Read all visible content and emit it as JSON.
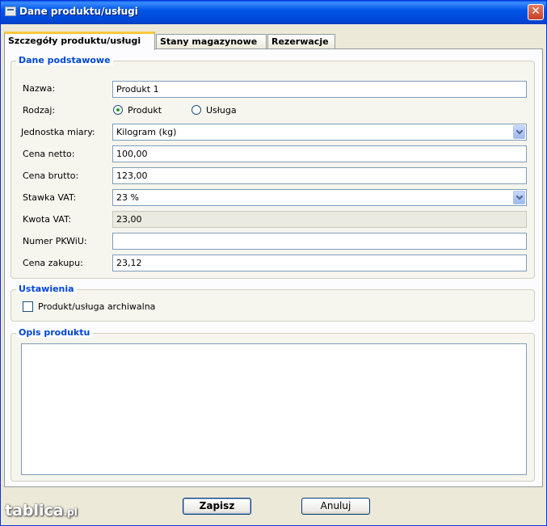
{
  "window": {
    "title": "Dane produktu/usługi",
    "close_label": "✕"
  },
  "tabs": [
    {
      "label": "Szczegóły produktu/usługi",
      "active": true
    },
    {
      "label": "Stany magazynowe",
      "active": false
    },
    {
      "label": "Rezerwacje",
      "active": false
    }
  ],
  "basic": {
    "legend": "Dane podstawowe",
    "name_label": "Nazwa:",
    "name_value": "Produkt 1",
    "type_label": "Rodzaj:",
    "type_options": [
      {
        "label": "Produkt",
        "selected": true
      },
      {
        "label": "Usługa",
        "selected": false
      }
    ],
    "unit_label": "Jednostka miary:",
    "unit_value": "Kilogram (kg)",
    "net_label": "Cena netto:",
    "net_value": "100,00",
    "gross_label": "Cena brutto:",
    "gross_value": "123,00",
    "vat_rate_label": "Stawka VAT:",
    "vat_rate_value": "23 %",
    "vat_amount_label": "Kwota VAT:",
    "vat_amount_value": "23,00",
    "pkwiu_label": "Numer PKWiU:",
    "pkwiu_value": "",
    "purchase_label": "Cena zakupu:",
    "purchase_value": "23,12"
  },
  "settings": {
    "legend": "Ustawienia",
    "archive_label": "Produkt/usługa archiwalna",
    "archive_checked": false
  },
  "description": {
    "legend": "Opis produktu",
    "value": ""
  },
  "buttons": {
    "save": "Zapisz",
    "cancel": "Anuluj"
  },
  "watermark": {
    "main": "tablica",
    "suffix": ".pl"
  }
}
